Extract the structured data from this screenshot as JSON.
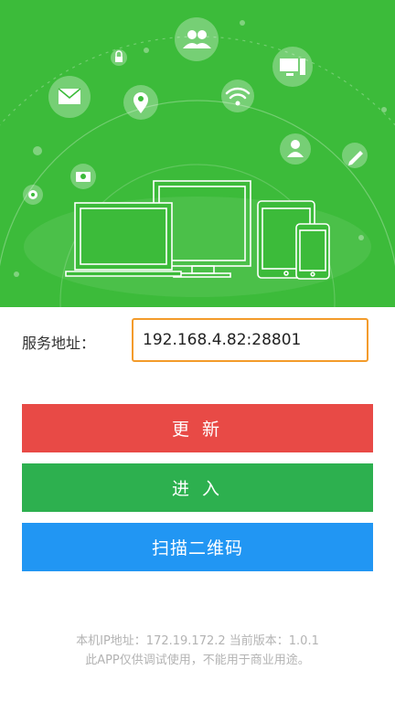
{
  "form": {
    "server_label": "服务地址：",
    "server_value": "192.168.4.82:28801"
  },
  "buttons": {
    "update": "更 新",
    "enter": "进 入",
    "scan": "扫描二维码"
  },
  "footer": {
    "line1": "本机IP地址：172.19.172.2   当前版本：1.0.1",
    "line2": "此APP仅供调试使用，不能用于商业用途。"
  },
  "colors": {
    "hero_green": "#3cbb3a",
    "update_red": "#e84a46",
    "enter_green": "#2db04f",
    "scan_blue": "#2196f3",
    "input_border": "#f39b2a"
  },
  "icons": [
    "users-icon",
    "lock-icon",
    "monitor-icon",
    "mail-icon",
    "location-icon",
    "wifi-icon",
    "user-icon",
    "pencil-icon",
    "camera-icon",
    "settings-icon"
  ]
}
